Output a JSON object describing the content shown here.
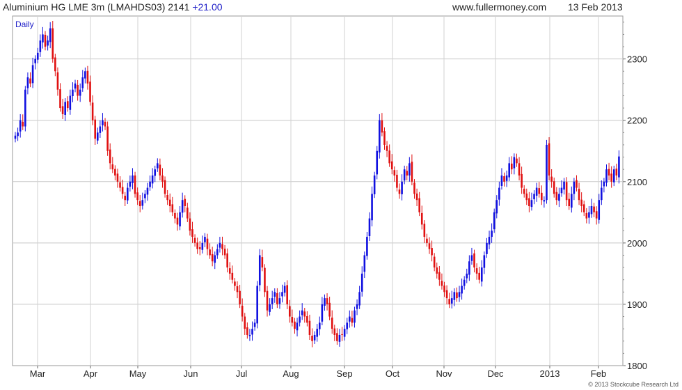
{
  "header": {
    "title": "Aluminium HG LME 3m (LMAHDS03) 2141",
    "change": "+21.00",
    "site": "www.fullermoney.com",
    "date": "13 Feb 2013"
  },
  "chart_data": {
    "type": "candlestick",
    "title": "Aluminium HG LME 3m (LMAHDS03)",
    "interval_label": "Daily",
    "last": 2141,
    "change": 21.0,
    "copyright": "© 2013 Stockcube Research Ltd",
    "ylim": [
      1800,
      2370
    ],
    "yticks": [
      1800,
      1900,
      2000,
      2100,
      2200,
      2300
    ],
    "xlabels": [
      "Mar",
      "Apr",
      "May",
      "Jun",
      "Jul",
      "Aug",
      "Sep",
      "Oct",
      "Nov",
      "Dec",
      "2013",
      "Feb"
    ],
    "grid": true,
    "up_color": "#1010e0",
    "down_color": "#e01010",
    "closes": [
      2175,
      2180,
      2200,
      2190,
      2250,
      2270,
      2260,
      2290,
      2300,
      2310,
      2330,
      2340,
      2320,
      2330,
      2350,
      2300,
      2280,
      2250,
      2220,
      2210,
      2230,
      2220,
      2240,
      2250,
      2260,
      2240,
      2250,
      2270,
      2280,
      2260,
      2230,
      2200,
      2170,
      2180,
      2190,
      2200,
      2190,
      2150,
      2130,
      2120,
      2110,
      2100,
      2090,
      2080,
      2070,
      2090,
      2100,
      2110,
      2080,
      2070,
      2060,
      2070,
      2080,
      2090,
      2100,
      2110,
      2120,
      2130,
      2110,
      2100,
      2080,
      2070,
      2060,
      2050,
      2040,
      2030,
      2050,
      2070,
      2060,
      2040,
      2020,
      2010,
      2000,
      1990,
      1990,
      2000,
      2010,
      1990,
      1980,
      1970,
      1980,
      1990,
      2000,
      1990,
      1980,
      1960,
      1950,
      1940,
      1930,
      1920,
      1900,
      1880,
      1860,
      1850,
      1850,
      1860,
      1870,
      1930,
      1980,
      1960,
      1920,
      1890,
      1900,
      1910,
      1920,
      1900,
      1910,
      1920,
      1930,
      1900,
      1880,
      1870,
      1860,
      1870,
      1880,
      1890,
      1880,
      1870,
      1850,
      1840,
      1850,
      1860,
      1870,
      1900,
      1910,
      1900,
      1880,
      1860,
      1850,
      1840,
      1850,
      1850,
      1860,
      1870,
      1880,
      1870,
      1890,
      1900,
      1920,
      1950,
      1980,
      2010,
      2040,
      2080,
      2110,
      2150,
      2200,
      2180,
      2160,
      2150,
      2130,
      2120,
      2110,
      2090,
      2080,
      2100,
      2120,
      2110,
      2130,
      2100,
      2080,
      2070,
      2050,
      2030,
      2010,
      2000,
      1990,
      1980,
      1960,
      1950,
      1940,
      1930,
      1920,
      1910,
      1900,
      1910,
      1920,
      1910,
      1920,
      1930,
      1940,
      1950,
      1970,
      1980,
      1960,
      1950,
      1940,
      1960,
      1980,
      2000,
      2010,
      2020,
      2050,
      2070,
      2090,
      2110,
      2100,
      2110,
      2130,
      2120,
      2140,
      2130,
      2110,
      2090,
      2080,
      2070,
      2060,
      2070,
      2080,
      2090,
      2080,
      2070,
      2070,
      2160,
      2110,
      2100,
      2080,
      2070,
      2080,
      2090,
      2100,
      2070,
      2060,
      2080,
      2100,
      2090,
      2070,
      2060,
      2050,
      2040,
      2050,
      2060,
      2050,
      2040,
      2070,
      2090,
      2100,
      2120,
      2110,
      2100,
      2120,
      2110,
      2141
    ]
  }
}
